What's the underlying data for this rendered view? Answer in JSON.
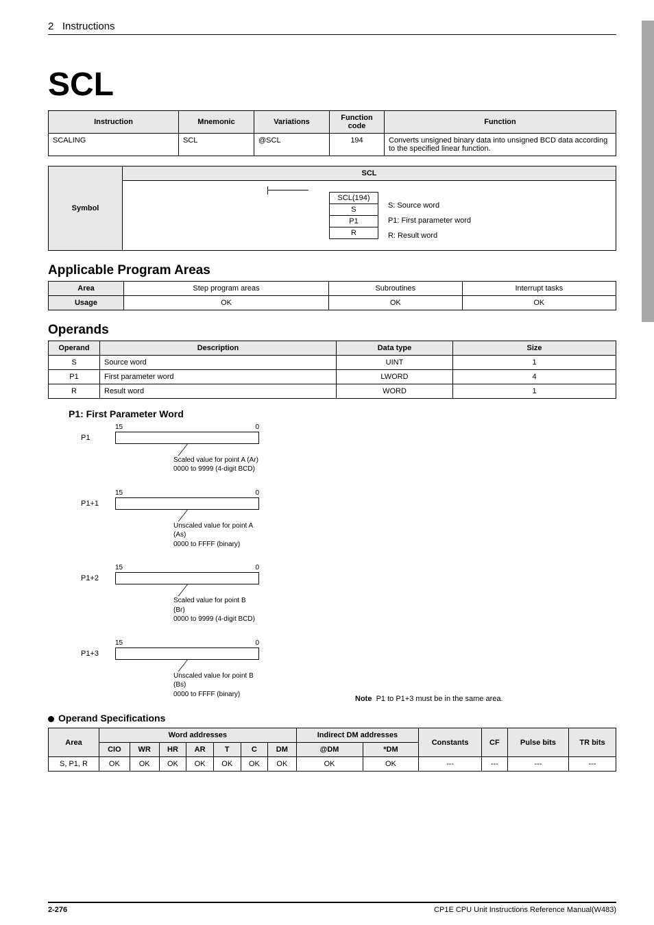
{
  "page_header": {
    "chapter_num": "2",
    "chapter_title": "Instructions"
  },
  "title": "SCL",
  "tb_instr": {
    "headers": [
      "Instruction",
      "Mnemonic",
      "Variations",
      "Function code",
      "Function"
    ],
    "row": {
      "instruction": "SCALING",
      "mnemonic": "SCL",
      "variations": "@SCL",
      "code": "194",
      "function": "Converts unsigned binary data into unsigned BCD data according to the specified linear function."
    }
  },
  "tb_symbol": {
    "head_group": "SCL",
    "row_label": "Symbol",
    "block_top": "SCL(194)",
    "params": [
      {
        "sym": "S",
        "desc": "S: Source word"
      },
      {
        "sym": "P1",
        "desc": "P1: First parameter word"
      },
      {
        "sym": "R",
        "desc": "R: Result word"
      }
    ]
  },
  "sec_areas": {
    "title": "Applicable Program Areas",
    "headers": [
      "Area",
      "Step program areas",
      "Subroutines",
      "Interrupt tasks"
    ],
    "row_label": "Usage",
    "cells": [
      "OK",
      "OK",
      "OK"
    ]
  },
  "sec_oper": {
    "title": "Operands",
    "headers": [
      "Operand",
      "Description",
      "Data type",
      "Size"
    ],
    "rows": [
      {
        "op": "S",
        "desc": "Source word",
        "dtype": "UINT",
        "size": "1"
      },
      {
        "op": "P1",
        "desc": "First parameter word",
        "dtype": "LWORD",
        "size": "4"
      },
      {
        "op": "R",
        "desc": "Result word",
        "dtype": "WORD",
        "size": "1"
      }
    ]
  },
  "sec_p1": {
    "title": "P1: First Parameter Word",
    "bit_hi": "15",
    "bit_lo": "0",
    "words": [
      {
        "tag": "P1",
        "desc1": "Scaled value for point A (Ar)",
        "desc2": "0000 to 9999 (4-digit BCD)"
      },
      {
        "tag": "P1+1",
        "desc1": "Unscaled value for point A (As)",
        "desc2": "0000 to FFFF (binary)"
      },
      {
        "tag": "P1+2",
        "desc1": "Scaled value for point B (Br)",
        "desc2": "0000 to 9999 (4-digit BCD)"
      },
      {
        "tag": "P1+3",
        "desc1": "Unscaled value for point B (Bs)",
        "desc2": "0000 to FFFF (binary)"
      }
    ],
    "note_label": "Note",
    "note_text": "P1 to P1+3 must be in the same area."
  },
  "sec_spec": {
    "title": "Operand Specifications",
    "group_word": "Word addresses",
    "group_idm": "Indirect DM addresses",
    "head_row2": [
      "CIO",
      "WR",
      "HR",
      "AR",
      "T",
      "C",
      "DM",
      "@DM",
      "*DM"
    ],
    "h_area": "Area",
    "h_const": "Constants",
    "h_cf": "CF",
    "h_pulse": "Pulse bits",
    "h_tr": "TR bits",
    "row_label": "S, P1, R",
    "cells": [
      "OK",
      "OK",
      "OK",
      "OK",
      "OK",
      "OK",
      "OK",
      "OK",
      "OK",
      "---",
      "---",
      "---",
      "---"
    ]
  },
  "footer": {
    "left": "2-276",
    "right": "CP1E CPU Unit Instructions Reference Manual(W483)"
  }
}
